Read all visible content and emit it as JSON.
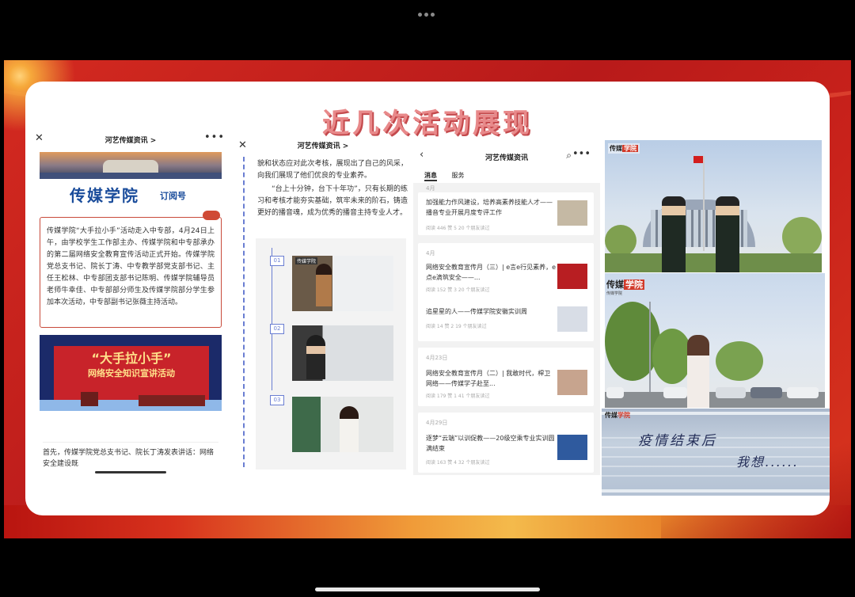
{
  "slide": {
    "title": "近几次活动展现"
  },
  "panel1": {
    "nav_title": "河艺传媒资讯 >",
    "close_glyph": "✕",
    "more_glyph": "•••",
    "brand": "传媒学院",
    "brand_sub": "订阅号",
    "body": "传媒学院“大手拉小手”活动走入中专部，4月24日上午，由学校学生工作部主办、传媒学院和中专部承办的第二届网络安全教育宣传活动正式开始。传媒学院党总支书记、院长丁涛、中专教学部党支部书记、主任王松林、中专部团支部书记陈明、传媒学院辅导员老师牛幸佳、中专部部分师生及传媒学院部分学生参加本次活动，中专部副书记张薇主持活动。",
    "banner_line1": "“大手拉小手”",
    "banner_line2": "网络安全知识宣讲活动",
    "bottom_text": "首先，传媒学院党总支书记、院长丁涛发表讲话：网络安全建设既"
  },
  "panel2": {
    "nav_title": "河艺传媒资讯 >",
    "close_glyph": "✕",
    "para1": "貌和状态应对此次考核，展现出了自己的风采，向我们展现了他们优良的专业素养。",
    "para2": "“台上十分钟，台下十年功”，只有长期的练习和考核才能夯实基础，筑牢未来的阶石，铸造更好的播音魂，成为优秀的播音主持专业人才。",
    "steps": [
      "01",
      "02",
      "03"
    ],
    "photo_logo": "传媒学院"
  },
  "panel3": {
    "back_glyph": "‹",
    "title": "河艺传媒资讯",
    "search_glyph": "⌕",
    "more_glyph": "•••",
    "tabs": [
      "消息",
      "服务"
    ],
    "top_date": "4月",
    "items": [
      {
        "title": "加强能力作风建设，培养高素养技能人才——播音专业开展月度专评工作",
        "meta": "阅读 446  赞 5  20 个朋友读过",
        "thumb_color": "#c5b9a4"
      },
      {
        "date": "4月",
        "title": "网络安全教育宣传月（三）| e言e行见素养，e点e滴筑安全——...",
        "meta": "阅读 152  赞 3  20 个朋友读过",
        "thumb_color": "#b81e22"
      },
      {
        "title": "追星星的人——传媒学院安徽实训周",
        "meta": "阅读 14  赞 2  19 个朋友读过",
        "thumb_color": "#d8dde6"
      },
      {
        "date": "4月23日",
        "title": "网络安全教育宣传月（二）| 我敢时代，桿卫网络——传媒学子赴至...",
        "meta": "阅读 179  赞 1  41 个朋友读过",
        "thumb_color": "#c7a48e"
      },
      {
        "date": "4月29日",
        "title": "逐梦“云端”以训促教——20级空乘专业实训圆满结束",
        "meta": "阅读 163  赞 4  32 个朋友读过",
        "thumb_color": "#2f5a9e"
      }
    ]
  },
  "panel4": {
    "logo_a": "传媒",
    "logo_b": "学院",
    "logo_small": "传媒学院",
    "handwriting1": "疫情结束后",
    "handwriting2": "我想......"
  },
  "colors": {
    "slide_red": "#c9221b",
    "title_pink": "#e8898a",
    "brand_blue": "#1a4c9b",
    "timeline_blue": "#6a7ed2"
  }
}
